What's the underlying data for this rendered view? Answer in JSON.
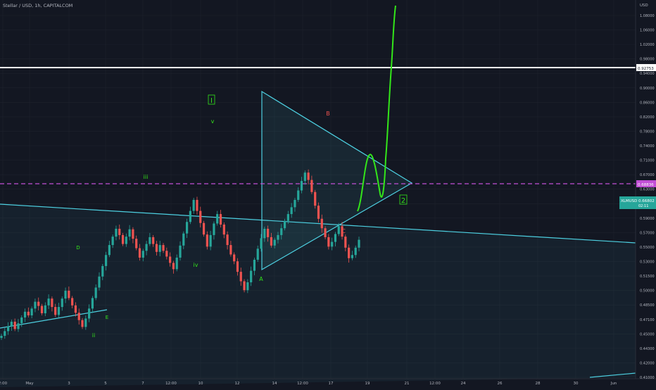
{
  "header": {
    "symbol_label": "Stellar / USD, 1h, CAPITALCOM",
    "currency": "USD"
  },
  "price_tags": {
    "white_level": "0.92753",
    "magenta_level": "0.68836",
    "current_name": "XLMUSD",
    "current_price": "0.66802",
    "current_sub": "02:11"
  },
  "colors": {
    "background": "#131722",
    "up": "#26a69a",
    "down": "#ef5350",
    "channel": "#4dd0e1",
    "projection": "#33e61a",
    "magenta": "#c24fd6",
    "white_line": "#ffffff",
    "wave_label": "#33e61a",
    "abc_label_red": "#ef5350"
  },
  "chart_data": {
    "type": "candlestick",
    "title": "",
    "instrument": "Stellar / USD",
    "interval": "1h",
    "exchange": "CAPITALCOM",
    "ylim": [
      0.4,
      1.1
    ],
    "y_ticks": [
      "1.08000",
      "1.06000",
      "1.02000",
      "0.98000",
      "0.94000",
      "0.90000",
      "0.86000",
      "0.82000",
      "0.78000",
      "0.74000",
      "0.71000",
      "0.67000",
      "0.63000",
      "0.61000",
      "0.59000",
      "0.57000",
      "0.55000",
      "0.53000",
      "0.51500",
      "0.50000",
      "0.48500",
      "0.47100",
      "0.45000",
      "0.44300",
      "0.42000",
      "0.41000"
    ],
    "x_ticks": [
      "2:00",
      "May",
      "3",
      "5",
      "7",
      "12:00",
      "10",
      "12",
      "14",
      "12:00",
      "17",
      "19",
      "21",
      "12:00",
      "24",
      "26",
      "28",
      "30",
      "Jun"
    ],
    "horizontal_levels": [
      {
        "name": "white",
        "value": 0.9275
      },
      {
        "name": "magenta-dashed",
        "value": 0.6884
      }
    ],
    "series": [
      {
        "values": [
          0.479,
          0.488,
          0.497,
          0.506,
          0.492,
          0.503,
          0.514,
          0.525,
          0.518,
          0.531,
          0.544,
          0.536,
          0.522,
          0.537,
          0.55,
          0.534,
          0.519,
          0.534,
          0.55,
          0.565,
          0.551,
          0.537,
          0.523,
          0.509,
          0.496,
          0.512,
          0.531,
          0.551,
          0.571,
          0.592,
          0.612,
          0.633,
          0.652,
          0.668,
          0.683,
          0.671,
          0.654,
          0.668,
          0.682,
          0.664,
          0.646,
          0.628,
          0.641,
          0.654,
          0.667,
          0.654,
          0.639,
          0.652,
          0.641,
          0.63,
          0.618,
          0.606,
          0.628,
          0.651,
          0.674,
          0.696,
          0.717,
          0.738,
          0.717,
          0.694,
          0.672,
          0.649,
          0.671,
          0.693,
          0.711,
          0.691,
          0.672,
          0.652,
          0.634,
          0.621,
          0.601,
          0.583,
          0.566,
          0.581,
          0.603,
          0.624,
          0.645,
          0.665,
          0.683,
          0.667,
          0.651,
          0.662,
          0.671,
          0.684,
          0.698,
          0.711,
          0.724,
          0.738,
          0.756,
          0.774,
          0.79,
          0.776,
          0.753,
          0.727,
          0.702,
          0.684,
          0.667,
          0.649,
          0.658,
          0.673,
          0.688,
          0.668,
          0.647,
          0.627,
          0.633,
          0.647,
          0.662
        ]
      }
    ],
    "annotations": {
      "waves": [
        "I",
        "ii",
        "iii",
        "iv",
        "v",
        "1",
        "2",
        "A",
        "B",
        "C",
        "D",
        "E"
      ]
    }
  }
}
